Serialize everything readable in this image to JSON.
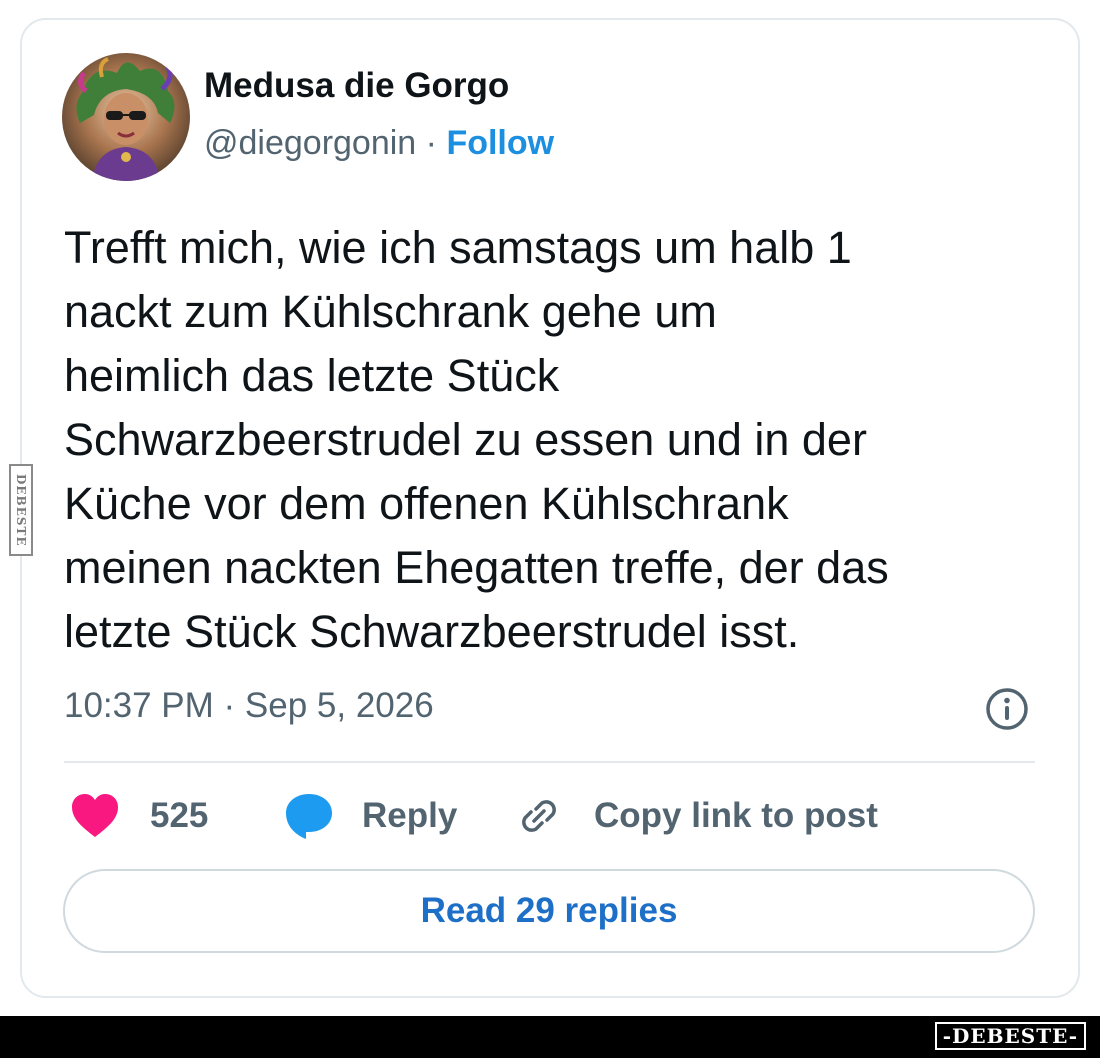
{
  "post": {
    "author_name": "Medusa die Gorgo",
    "handle": "@diegorgonin",
    "separator": " · ",
    "follow_label": "Follow",
    "text": "Trefft mich, wie ich samstags um halb 1\nnackt zum Kühlschrank gehe um\nheimlich das letzte Stück\nSchwarzbeerstrudel zu essen und in der\nKüche vor dem offenen Kühlschrank\nmeinen nackten Ehegatten treffe, der das\nletzte Stück Schwarzbeerstrudel isst.",
    "timestamp": "10:37 PM · Sep 5, 2026"
  },
  "actions": {
    "like_count": "525",
    "reply_label": "Reply",
    "copy_link_label": "Copy link to post"
  },
  "read_replies_label": "Read 29 replies",
  "watermark": {
    "side": "DEBESTE",
    "logo": "-DEBESTE-"
  },
  "colors": {
    "heart": "#f91880",
    "reply_bubble": "#1d9bf0",
    "follow": "#1d8fe0",
    "read_replies": "#1d6fc7",
    "secondary_text": "#536471",
    "primary_text": "#0f1419"
  },
  "icons": {
    "like": "heart-icon",
    "reply": "speech-bubble-icon",
    "copy_link": "link-icon",
    "info": "info-icon"
  }
}
